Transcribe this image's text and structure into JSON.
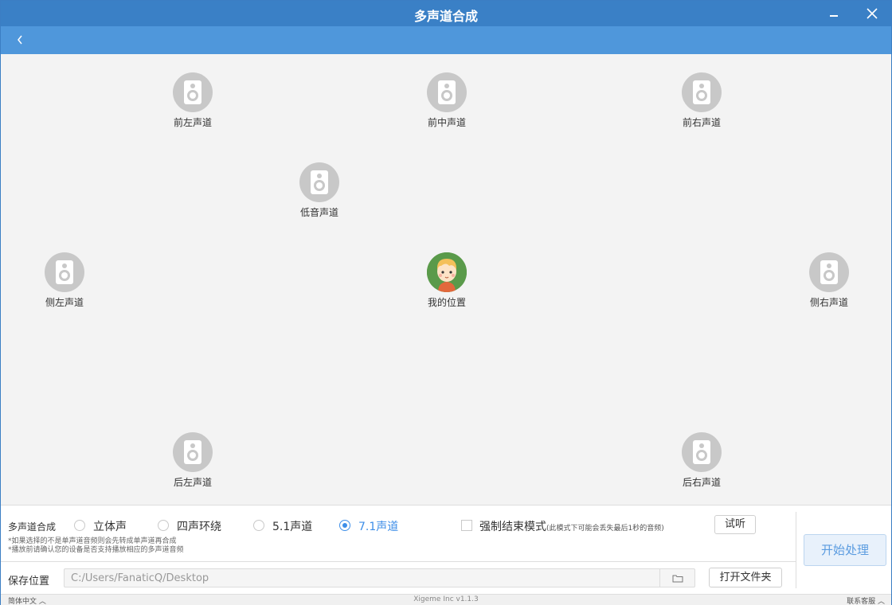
{
  "window": {
    "title": "多声道合成",
    "minimize_icon": "minimize-icon",
    "close_icon": "close-icon"
  },
  "navbar": {
    "back_icon": "chevron-left-icon"
  },
  "stage": {
    "speakers": {
      "front_left": "前左声道",
      "front_center": "前中声道",
      "front_right": "前右声道",
      "bass": "低音声道",
      "side_left": "侧左声道",
      "me": "我的位置",
      "side_right": "侧右声道",
      "rear_left": "后左声道",
      "rear_right": "后右声道"
    },
    "speaker_icon": "speaker-icon",
    "me_icon": "avatar-icon"
  },
  "options": {
    "label": "多声道合成",
    "modes": [
      "立体声",
      "四声环绕",
      "5.1声道",
      "7.1声道"
    ],
    "selected": "7.1声道",
    "force_end_label": "强制结束模式",
    "force_end_note": "(此模式下可能会丢失最后1秒的音频)",
    "force_end_checked": false,
    "preview_label": "试听",
    "notes": [
      "*如果选择的不是单声道音频则会先转成单声道再合成",
      "*播放前请确认您的设备是否支持播放相应的多声道音频"
    ]
  },
  "save": {
    "label": "保存位置",
    "path": "C:/Users/FanaticQ/Desktop",
    "browse_icon": "folder-icon",
    "open_folder_label": "打开文件夹"
  },
  "start_label": "开始处理",
  "statusbar": {
    "language": "简体中文",
    "version": "Xigeme Inc v1.1.3",
    "support": "联系客服"
  },
  "colors": {
    "titlebar": "#3a80c6",
    "navbar": "#4f97db",
    "accent": "#3d8ee8",
    "speaker": "#c8c8c8",
    "avatar_bg": "#5a9a4a"
  }
}
